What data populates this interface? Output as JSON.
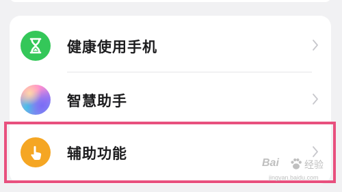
{
  "settings": {
    "items": [
      {
        "label": "健康使用手机",
        "icon": "hourglass-icon",
        "icon_color": "#34c759"
      },
      {
        "label": "智慧助手",
        "icon": "gradient-orb-icon",
        "icon_color": "#ff8fcf"
      },
      {
        "label": "辅助功能",
        "icon": "hand-pointer-icon",
        "icon_color": "#f5a623"
      }
    ]
  },
  "colors": {
    "background": "#f1f1f3",
    "card": "#ffffff",
    "highlight_border": "#e8507e",
    "chevron": "#c7c7cc"
  },
  "watermark": {
    "brand": "Bai",
    "word": "经验",
    "url": "jingyan.baidu.com"
  }
}
